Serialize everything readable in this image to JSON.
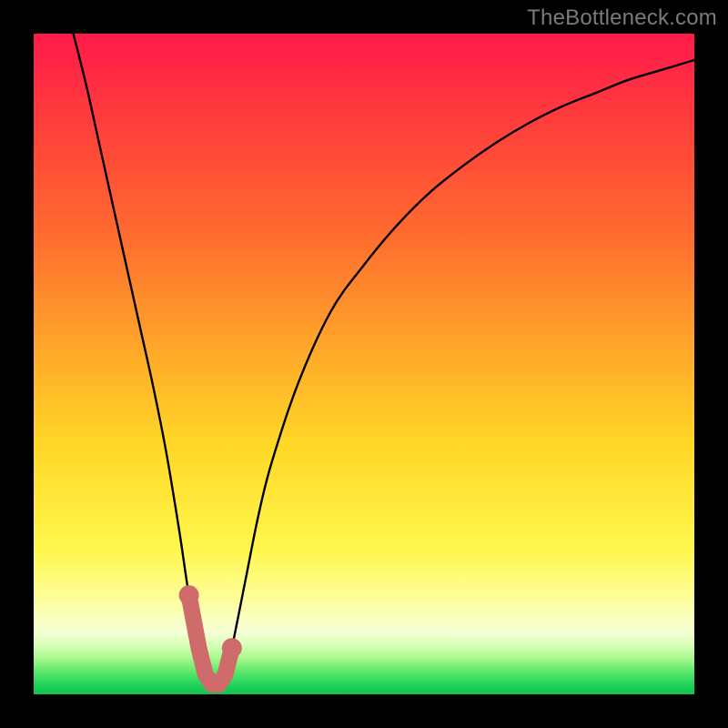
{
  "watermark": "TheBottleneck.com",
  "colors": {
    "page_bg": "#000000",
    "curve": "#000000",
    "marker_fill": "#cf6b6b",
    "marker_stroke": "#cf6b6b",
    "gradient_stops": [
      {
        "offset": 0.0,
        "color": "#ff1a4a"
      },
      {
        "offset": 0.12,
        "color": "#ff3a3d"
      },
      {
        "offset": 0.3,
        "color": "#ff6a2f"
      },
      {
        "offset": 0.48,
        "color": "#ffa829"
      },
      {
        "offset": 0.62,
        "color": "#ffd726"
      },
      {
        "offset": 0.78,
        "color": "#fff74c"
      },
      {
        "offset": 0.86,
        "color": "#fdffa0"
      },
      {
        "offset": 0.905,
        "color": "#f6ffd6"
      },
      {
        "offset": 0.925,
        "color": "#d8ffb8"
      },
      {
        "offset": 0.945,
        "color": "#a8f98f"
      },
      {
        "offset": 0.965,
        "color": "#5fe86a"
      },
      {
        "offset": 0.985,
        "color": "#20d45a"
      },
      {
        "offset": 1.0,
        "color": "#14c04f"
      }
    ]
  },
  "chart_data": {
    "type": "line",
    "title": "",
    "xlabel": "",
    "ylabel": "",
    "xlim": [
      0,
      100
    ],
    "ylim": [
      0,
      100
    ],
    "series": [
      {
        "name": "bottleneck-curve",
        "x": [
          6,
          8,
          10,
          12,
          14,
          16,
          18,
          20,
          22,
          23.5,
          25,
          26,
          27,
          28,
          29,
          30,
          32,
          34,
          36,
          40,
          45,
          50,
          55,
          60,
          65,
          70,
          75,
          80,
          85,
          90,
          95,
          100
        ],
        "y": [
          100,
          92,
          83,
          74,
          65,
          56,
          47,
          37,
          25,
          15,
          7,
          3,
          1.5,
          1.5,
          3,
          7,
          17,
          27,
          35,
          47,
          58,
          65,
          71,
          76,
          80,
          83.5,
          86.5,
          89,
          91,
          93,
          94.5,
          96
        ]
      }
    ],
    "markers": {
      "name": "highlighted-min-points",
      "x": [
        23.5,
        25,
        26,
        27,
        28,
        29,
        30
      ],
      "y": [
        15,
        7,
        3,
        1.5,
        1.5,
        3,
        7
      ]
    }
  }
}
